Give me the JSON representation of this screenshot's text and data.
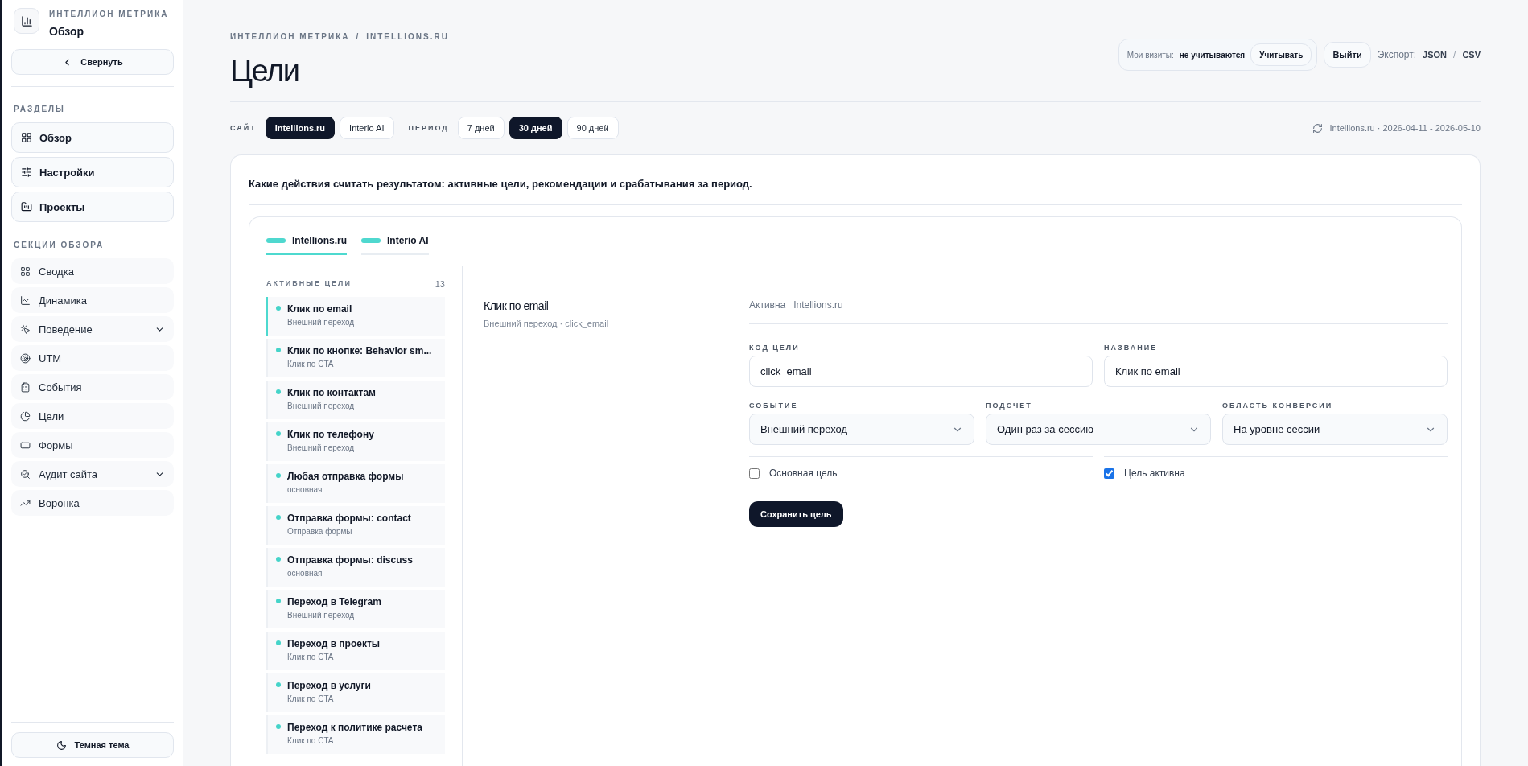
{
  "sidebar": {
    "brand_label": "ИНТЕЛЛИОН МЕТРИКА",
    "brand_title": "Обзор",
    "collapse_button": "Свернуть",
    "sections_label": "РАЗДЕЛЫ",
    "sections": [
      {
        "label": "Обзор"
      },
      {
        "label": "Настройки"
      },
      {
        "label": "Проекты"
      }
    ],
    "overview_label": "СЕКЦИИ ОБЗОРА",
    "overview_items": [
      {
        "label": "Сводка",
        "expandable": false
      },
      {
        "label": "Динамика",
        "expandable": false
      },
      {
        "label": "Поведение",
        "expandable": true
      },
      {
        "label": "UTM",
        "expandable": false
      },
      {
        "label": "События",
        "expandable": false
      },
      {
        "label": "Цели",
        "expandable": false
      },
      {
        "label": "Формы",
        "expandable": false
      },
      {
        "label": "Аудит сайта",
        "expandable": true
      },
      {
        "label": "Воронка",
        "expandable": false
      }
    ],
    "theme_button": "Темная тема"
  },
  "header": {
    "breadcrumb": [
      "ИНТЕЛЛИОН МЕТРИКА",
      "INTELLIONS.RU"
    ],
    "breadcrumb_separator": "/",
    "title": "Цели",
    "visits_label": "Мои визиты:",
    "visits_value": "не учитываются",
    "visits_button": "Учитывать",
    "logout_button": "Выйти",
    "export_label": "Экспорт:",
    "export_links": [
      "JSON",
      "CSV"
    ],
    "export_separator": "/"
  },
  "filters": {
    "site_label": "САЙТ",
    "sites": [
      {
        "label": "Intellions.ru",
        "selected": true
      },
      {
        "label": "Interio AI",
        "selected": false
      }
    ],
    "period_label": "ПЕРИОД",
    "periods": [
      {
        "label": "7 дней",
        "selected": false
      },
      {
        "label": "30 дней",
        "selected": true
      },
      {
        "label": "90 дней",
        "selected": false
      }
    ],
    "range": "Intellions.ru · 2026-04-11 - 2026-05-10"
  },
  "panel": {
    "description": "Какие действия считать результатом: активные цели, рекомендации и срабатывания за период.",
    "site_tabs": [
      {
        "label": "Intellions.ru",
        "selected": true
      },
      {
        "label": "Interio AI",
        "selected": false
      }
    ],
    "goals_label": "АКТИВНЫЕ ЦЕЛИ",
    "goals_count": "13",
    "goals": [
      {
        "name": "Клик по email",
        "type": "Внешний переход",
        "selected": true
      },
      {
        "name": "Клик по кнопке: Behavior sm...",
        "type": "Клик по CTA",
        "selected": false
      },
      {
        "name": "Клик по контактам",
        "type": "Внешний переход",
        "selected": false
      },
      {
        "name": "Клик по телефону",
        "type": "Внешний переход",
        "selected": false
      },
      {
        "name": "Любая отправка формы",
        "type": "основная",
        "selected": false
      },
      {
        "name": "Отправка формы: contact",
        "type": "Отправка формы",
        "selected": false
      },
      {
        "name": "Отправка формы: discuss",
        "type": "основная",
        "selected": false
      },
      {
        "name": "Переход в Telegram",
        "type": "Внешний переход",
        "selected": false
      },
      {
        "name": "Переход в проекты",
        "type": "Клик по CTA",
        "selected": false
      },
      {
        "name": "Переход в услуги",
        "type": "Клик по CTA",
        "selected": false
      },
      {
        "name": "Переход к политике расчета",
        "type": "Клик по CTA",
        "selected": false
      }
    ],
    "detail": {
      "title": "Клик по email",
      "subtitle": "Внешний переход · click_email",
      "status": "Активна",
      "site": "Intellions.ru",
      "inputs": [
        {
          "label": "КОД ЦЕЛИ",
          "value": "click_email"
        },
        {
          "label": "НАЗВАНИЕ",
          "value": "Клик по email"
        }
      ],
      "selects": [
        {
          "label": "СОБЫТИЕ",
          "value": "Внешний переход"
        },
        {
          "label": "ПОДСЧЕТ",
          "value": "Один раз за сессию"
        },
        {
          "label": "ОБЛАСТЬ КОНВЕРСИИ",
          "value": "На уровне сессии"
        }
      ],
      "checkboxes": [
        {
          "label": "Основная цель",
          "checked": false
        },
        {
          "label": "Цель активна",
          "checked": true
        }
      ],
      "save_button": "Сохранить цель"
    }
  }
}
